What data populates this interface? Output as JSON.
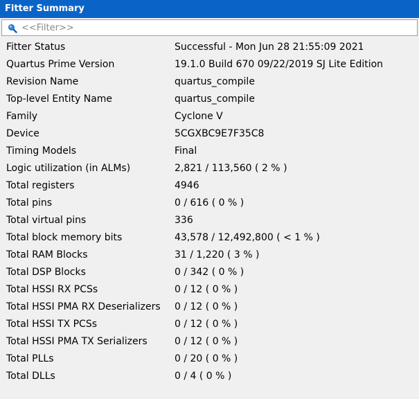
{
  "window": {
    "title": "Fitter Summary"
  },
  "filter": {
    "placeholder": "<<Filter>>",
    "value": "",
    "icon": "search-icon"
  },
  "colors": {
    "title_bar": "#0a64c8",
    "background": "#f0f0f0"
  },
  "rows": [
    {
      "label": "Fitter Status",
      "value": "Successful - Mon Jun 28 21:55:09 2021"
    },
    {
      "label": "Quartus Prime Version",
      "value": "19.1.0 Build 670 09/22/2019 SJ Lite Edition"
    },
    {
      "label": "Revision Name",
      "value": "quartus_compile"
    },
    {
      "label": "Top-level Entity Name",
      "value": "quartus_compile"
    },
    {
      "label": "Family",
      "value": "Cyclone V"
    },
    {
      "label": "Device",
      "value": "5CGXBC9E7F35C8"
    },
    {
      "label": "Timing Models",
      "value": "Final"
    },
    {
      "label": "Logic utilization (in ALMs)",
      "value": "2,821 / 113,560 ( 2 % )"
    },
    {
      "label": "Total registers",
      "value": "4946"
    },
    {
      "label": "Total pins",
      "value": "0 / 616 ( 0 % )"
    },
    {
      "label": "Total virtual pins",
      "value": "336"
    },
    {
      "label": "Total block memory bits",
      "value": "43,578 / 12,492,800 ( < 1 % )"
    },
    {
      "label": "Total RAM Blocks",
      "value": "31 / 1,220 ( 3 % )"
    },
    {
      "label": "Total DSP Blocks",
      "value": "0 / 342 ( 0 % )"
    },
    {
      "label": "Total HSSI RX PCSs",
      "value": "0 / 12 ( 0 % )"
    },
    {
      "label": "Total HSSI PMA RX Deserializers",
      "value": "0 / 12 ( 0 % )"
    },
    {
      "label": "Total HSSI TX PCSs",
      "value": "0 / 12 ( 0 % )"
    },
    {
      "label": "Total HSSI PMA TX Serializers",
      "value": "0 / 12 ( 0 % )"
    },
    {
      "label": "Total PLLs",
      "value": "0 / 20 ( 0 % )"
    },
    {
      "label": "Total DLLs",
      "value": "0 / 4 ( 0 % )"
    }
  ]
}
